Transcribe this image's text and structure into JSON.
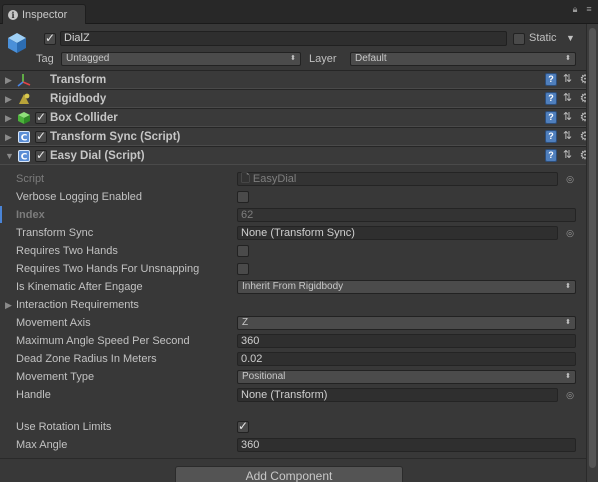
{
  "tab": {
    "label": "Inspector"
  },
  "object": {
    "name": "DialZ",
    "active": true,
    "static_label": "Static",
    "static": false
  },
  "tag": {
    "label": "Tag",
    "value": "Untagged"
  },
  "layer": {
    "label": "Layer",
    "value": "Default"
  },
  "components": [
    {
      "title": "Transform",
      "enabled": null,
      "expanded": false
    },
    {
      "title": "Rigidbody",
      "enabled": null,
      "expanded": false
    },
    {
      "title": "Box Collider",
      "enabled": true,
      "expanded": false
    },
    {
      "title": "Transform Sync (Script)",
      "enabled": true,
      "expanded": false
    },
    {
      "title": "Easy Dial (Script)",
      "enabled": true,
      "expanded": true
    }
  ],
  "properties": {
    "script": {
      "label": "Script",
      "value": "EasyDial"
    },
    "verbose_logging": {
      "label": "Verbose Logging Enabled",
      "checked": false
    },
    "index": {
      "label": "Index",
      "value": "62"
    },
    "transform_sync": {
      "label": "Transform Sync",
      "value": "None (Transform Sync)"
    },
    "requires_two_hands": {
      "label": "Requires Two Hands",
      "checked": false
    },
    "requires_two_hands_unsnap": {
      "label": "Requires Two Hands For Unsnapping",
      "checked": false
    },
    "is_kinematic": {
      "label": "Is Kinematic After Engage",
      "value": "Inherit From Rigidbody"
    },
    "interaction_requirements": {
      "label": "Interaction Requirements"
    },
    "movement_axis": {
      "label": "Movement Axis",
      "value": "Z"
    },
    "max_angle_speed": {
      "label": "Maximum Angle Speed Per Second",
      "value": "360"
    },
    "dead_zone": {
      "label": "Dead Zone Radius In Meters",
      "value": "0.02"
    },
    "movement_type": {
      "label": "Movement Type",
      "value": "Positional"
    },
    "handle": {
      "label": "Handle",
      "value": "None (Transform)"
    },
    "use_rotation_limits": {
      "label": "Use Rotation Limits",
      "checked": true
    },
    "max_angle": {
      "label": "Max Angle",
      "value": "360"
    }
  },
  "add_component": {
    "label": "Add Component"
  },
  "icons": {
    "tab": "info-icon",
    "object": "cube-icon",
    "transform": "transform-axes-icon",
    "rigidbody": "rigidbody-icon",
    "box_collider": "box-collider-icon",
    "script": "script-icon",
    "help": "help-icon",
    "presets": "presets-icon",
    "settings": "gear-icon"
  }
}
